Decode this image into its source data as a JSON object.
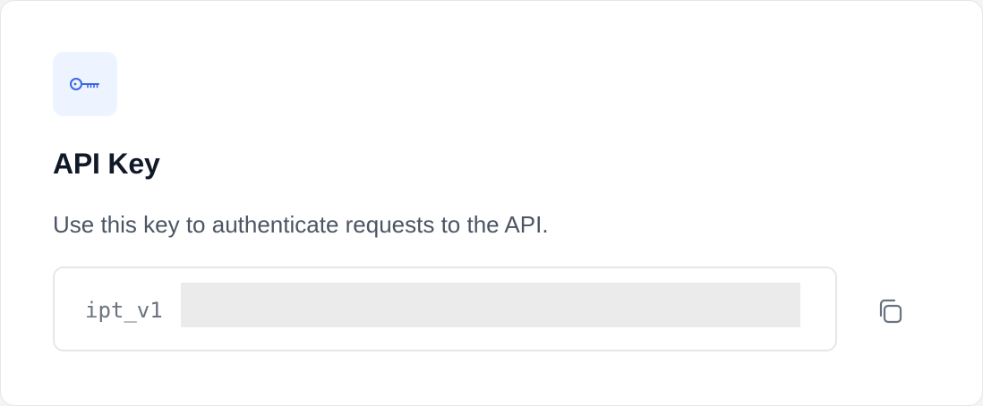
{
  "card": {
    "title": "API Key",
    "description": "Use this key to authenticate requests to the API.",
    "icon": "key-icon",
    "api_key": {
      "visible_prefix": "ipt_v1",
      "masked": true
    },
    "copy_icon": "copy-icon"
  },
  "colors": {
    "icon_accent": "#3b66e6",
    "icon_tile_bg": "#eef4ff",
    "title": "#111827",
    "description": "#4b5563",
    "field_border": "#e5e7eb",
    "mask": "#ebebeb",
    "copy_icon": "#6b7280"
  }
}
